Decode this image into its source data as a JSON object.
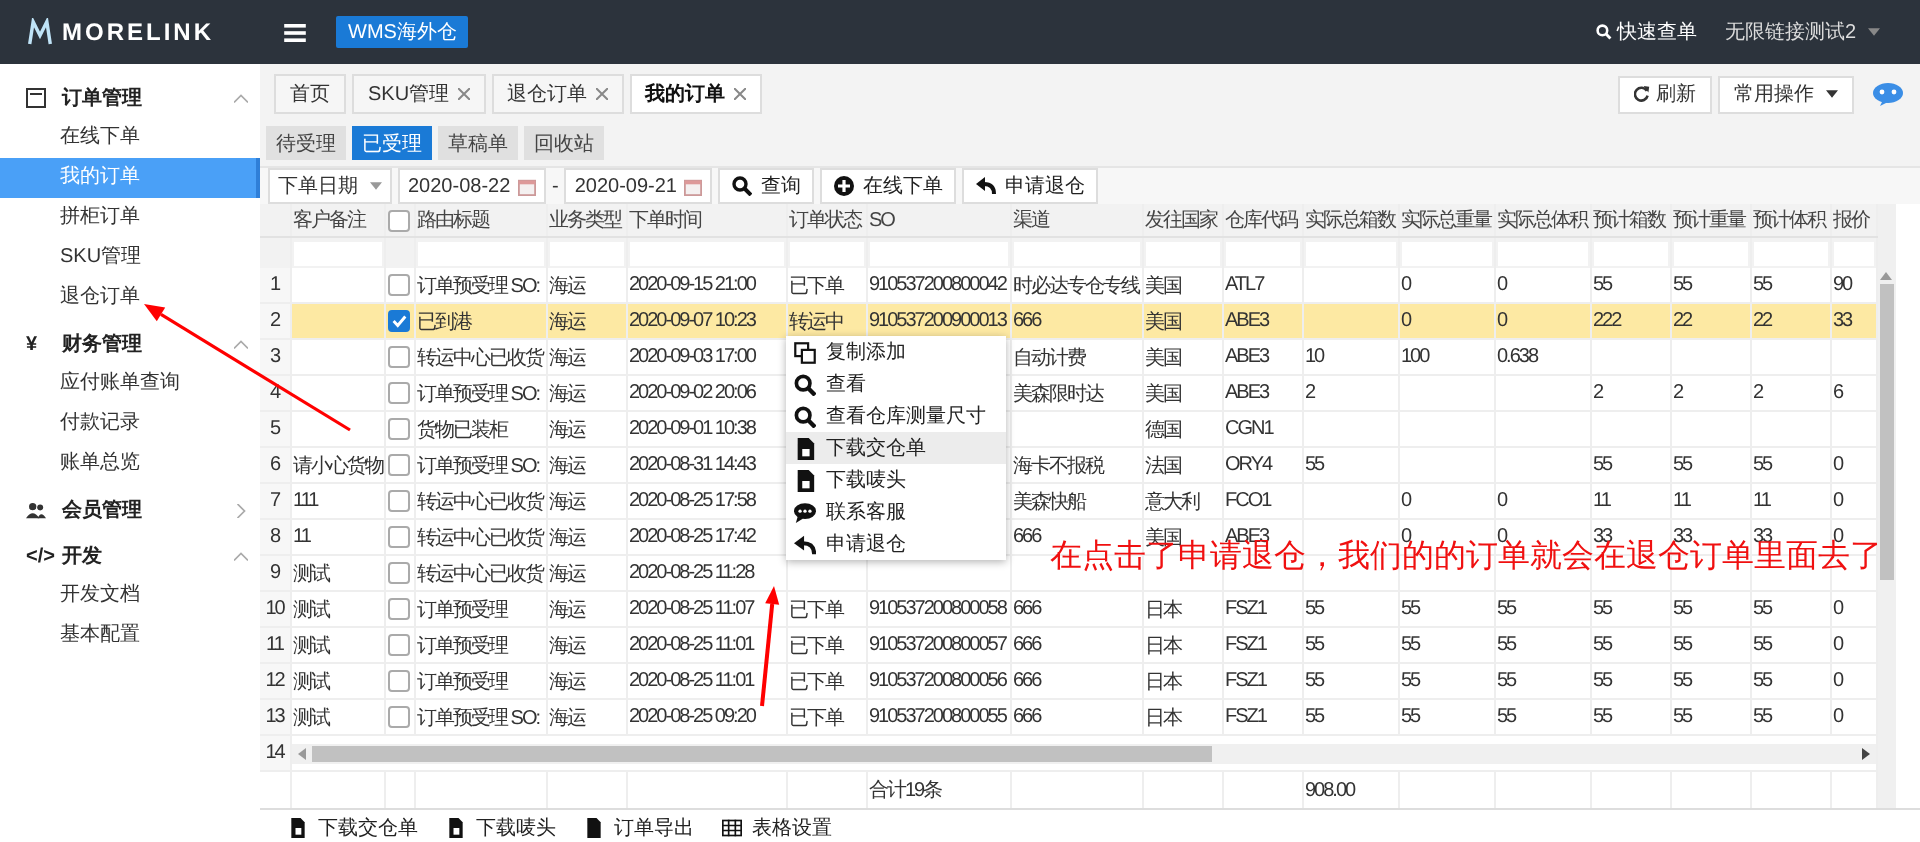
{
  "header": {
    "logo": "MORELINK",
    "module_button": "WMS海外仓",
    "quick_search": "快速查单",
    "user": "无限链接测试2"
  },
  "sidebar": {
    "sections": [
      {
        "kind": "document",
        "title": "订单管理",
        "expanded": true,
        "items": [
          {
            "label": "在线下单",
            "selected": false
          },
          {
            "label": "我的订单",
            "selected": true
          },
          {
            "label": "拼柜订单",
            "selected": false
          },
          {
            "label": "SKU管理",
            "selected": false
          },
          {
            "label": "退仓订单",
            "selected": false
          }
        ]
      },
      {
        "kind": "glyph",
        "glyph": "¥",
        "title": "财务管理",
        "expanded": true,
        "items": [
          {
            "label": "应付账单查询",
            "selected": false
          },
          {
            "label": "付款记录",
            "selected": false
          },
          {
            "label": "账单总览",
            "selected": false
          }
        ]
      },
      {
        "kind": "people",
        "title": "会员管理",
        "expanded": false
      },
      {
        "kind": "glyph",
        "glyph": "</>",
        "title": "开发",
        "expanded": true,
        "items": [
          {
            "label": "开发文档",
            "selected": false
          },
          {
            "label": "基本配置",
            "selected": false
          }
        ]
      }
    ]
  },
  "page_tabs": [
    {
      "label": "首页",
      "closable": false,
      "selected": false
    },
    {
      "label": "SKU管理",
      "closable": true,
      "selected": false
    },
    {
      "label": "退仓订单",
      "closable": true,
      "selected": false
    },
    {
      "label": "我的订单",
      "closable": true,
      "selected": true
    }
  ],
  "page_actions": {
    "refresh": "刷新",
    "common": "常用操作"
  },
  "status_tabs": [
    {
      "label": "待受理",
      "selected": false
    },
    {
      "label": "已受理",
      "selected": true
    },
    {
      "label": "草稿单",
      "selected": false
    },
    {
      "label": "回收站",
      "selected": false
    }
  ],
  "filter": {
    "date_field": "下单日期",
    "date_from": "2020-08-22",
    "separator": "-",
    "date_to": "2020-09-21",
    "buttons": [
      {
        "kind": "search",
        "label": "查询"
      },
      {
        "kind": "add",
        "label": "在线下单"
      },
      {
        "kind": "return",
        "label": "申请退仓"
      }
    ]
  },
  "table": {
    "header_checked": false,
    "columns": [
      "客户备注",
      "路由标题",
      "业务类型",
      "下单时间",
      "订单状态",
      "SO",
      "渠道",
      "发往国家",
      "仓库代码",
      "实际总箱数",
      "实际总重量",
      "实际总体积",
      "预计箱数",
      "预计重量",
      "预计体积",
      "报价"
    ],
    "rows": [
      {
        "number": "1",
        "checked": false,
        "selected": false,
        "cells": [
          "",
          "订单预受理 SO:",
          "海运",
          "2020-09-15 21:00",
          "已下单",
          "910537200800042",
          "时必达专仓专线",
          "美国",
          "ATL7",
          "",
          "0",
          "0",
          "55",
          "55",
          "55",
          "90"
        ]
      },
      {
        "number": "2",
        "checked": true,
        "selected": true,
        "cells": [
          "",
          "已到港",
          "海运",
          "2020-09-07 10:23",
          "转运中",
          "910537200900013",
          "666",
          "美国",
          "ABE3",
          "",
          "0",
          "0",
          "222",
          "22",
          "22",
          "33"
        ]
      },
      {
        "number": "3",
        "checked": false,
        "selected": false,
        "cells": [
          "",
          "转运中心已收货",
          "海运",
          "2020-09-03 17:00",
          "",
          "",
          "自动计费",
          "美国",
          "ABE3",
          "10",
          "100",
          "0.638",
          "",
          "",
          "",
          ""
        ]
      },
      {
        "number": "4",
        "checked": false,
        "selected": false,
        "cells": [
          "",
          "订单预受理 SO:",
          "海运",
          "2020-09-02 20:06",
          "",
          "",
          "美森限时达",
          "美国",
          "ABE3",
          "2",
          "",
          "",
          "2",
          "2",
          "2",
          "6"
        ]
      },
      {
        "number": "5",
        "checked": false,
        "selected": false,
        "cells": [
          "",
          "货物已装柜",
          "海运",
          "2020-09-01 10:38",
          "",
          "",
          "",
          "德国",
          "CGN1",
          "",
          "",
          "",
          "",
          "",
          "",
          ""
        ]
      },
      {
        "number": "6",
        "checked": false,
        "selected": false,
        "cells": [
          "请小心货物",
          "订单预受理 SO:",
          "海运",
          "2020-08-31 14:43",
          "",
          "",
          "海卡不报税",
          "法国",
          "ORY4",
          "55",
          "",
          "",
          "55",
          "55",
          "55",
          "0"
        ]
      },
      {
        "number": "7",
        "checked": false,
        "selected": false,
        "cells": [
          "111",
          "转运中心已收货",
          "海运",
          "2020-08-25 17:58",
          "",
          "",
          "美森快船",
          "意大利",
          "FCO1",
          "",
          "0",
          "0",
          "11",
          "11",
          "11",
          "0"
        ]
      },
      {
        "number": "8",
        "checked": false,
        "selected": false,
        "cells": [
          "11",
          "转运中心已收货",
          "海运",
          "2020-08-25 17:42",
          "",
          "",
          "666",
          "美国",
          "ABE3",
          "",
          "0",
          "0",
          "33",
          "33",
          "33",
          "0"
        ]
      },
      {
        "number": "9",
        "checked": false,
        "selected": false,
        "cells": [
          "测试",
          "转运中心已收货",
          "海运",
          "2020-08-25 11:28",
          "",
          "",
          "",
          "",
          "",
          "",
          "",
          "",
          "",
          "",
          "",
          ""
        ]
      },
      {
        "number": "10",
        "checked": false,
        "selected": false,
        "cells": [
          "测试",
          "订单预受理",
          "海运",
          "2020-08-25 11:07",
          "已下单",
          "910537200800058",
          "666",
          "日本",
          "FSZ1",
          "55",
          "55",
          "55",
          "55",
          "55",
          "55",
          "0"
        ]
      },
      {
        "number": "11",
        "checked": false,
        "selected": false,
        "cells": [
          "测试",
          "订单预受理",
          "海运",
          "2020-08-25 11:01",
          "已下单",
          "910537200800057",
          "666",
          "日本",
          "FSZ1",
          "55",
          "55",
          "55",
          "55",
          "55",
          "55",
          "0"
        ]
      },
      {
        "number": "12",
        "checked": false,
        "selected": false,
        "cells": [
          "测试",
          "订单预受理",
          "海运",
          "2020-08-25 11:01",
          "已下单",
          "910537200800056",
          "666",
          "日本",
          "FSZ1",
          "55",
          "55",
          "55",
          "55",
          "55",
          "55",
          "0"
        ]
      },
      {
        "number": "13",
        "checked": false,
        "selected": false,
        "cells": [
          "测试",
          "订单预受理 SO:",
          "海运",
          "2020-08-25 09:20",
          "已下单",
          "910537200800055",
          "666",
          "日本",
          "FSZ1",
          "55",
          "55",
          "55",
          "55",
          "55",
          "55",
          "0"
        ]
      }
    ],
    "partial_row_number": "14",
    "totals": {
      "count": "合计19条",
      "box_total": "908.00"
    }
  },
  "context_menu": [
    {
      "kind": "copy",
      "label": "复制添加",
      "hovered": false
    },
    {
      "kind": "view",
      "label": "查看",
      "hovered": false
    },
    {
      "kind": "view",
      "label": "查看仓库测量尺寸",
      "hovered": false
    },
    {
      "kind": "file",
      "label": "下载交仓单",
      "hovered": true
    },
    {
      "kind": "file",
      "label": "下载唛头",
      "hovered": false
    },
    {
      "kind": "chat",
      "label": "联系客服",
      "hovered": false
    },
    {
      "kind": "return",
      "label": "申请退仓",
      "hovered": false
    }
  ],
  "bottom_toolbar": [
    {
      "kind": "file",
      "label": "下载交仓单"
    },
    {
      "kind": "file",
      "label": "下载唛头"
    },
    {
      "kind": "doc",
      "label": "订单导出"
    },
    {
      "kind": "grid",
      "label": "表格设置"
    }
  ],
  "annotation": {
    "text": "在点击了申请退仓，我们的的订单就会在退仓订单里面去了"
  }
}
